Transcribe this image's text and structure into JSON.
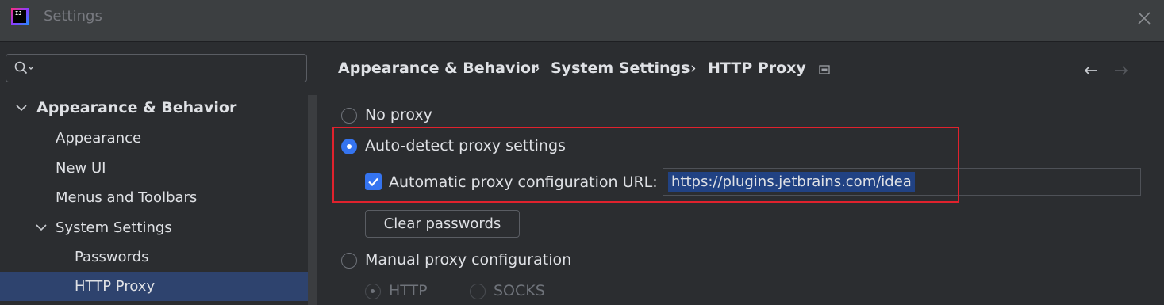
{
  "window": {
    "title": "Settings"
  },
  "search": {
    "placeholder": "",
    "value": ""
  },
  "sidebar": {
    "items": [
      {
        "label": "Appearance & Behavior",
        "level": 0,
        "expanded": true
      },
      {
        "label": "Appearance",
        "level": 1
      },
      {
        "label": "New UI",
        "level": 1
      },
      {
        "label": "Menus and Toolbars",
        "level": 1
      },
      {
        "label": "System Settings",
        "level": 1,
        "expanded": true
      },
      {
        "label": "Passwords",
        "level": 2
      },
      {
        "label": "HTTP Proxy",
        "level": 2,
        "selected": true
      }
    ]
  },
  "breadcrumb": {
    "items": [
      "Appearance & Behavior",
      "System Settings",
      "HTTP Proxy"
    ],
    "separator": "›"
  },
  "proxy": {
    "no_proxy": {
      "label": "No proxy",
      "checked": false
    },
    "auto_detect": {
      "label": "Auto-detect proxy settings",
      "checked": true
    },
    "auto_config_url": {
      "label": "Automatic proxy configuration URL:",
      "checked": true,
      "value": "https://plugins.jetbrains.com/idea"
    },
    "clear_passwords_label": "Clear passwords",
    "manual": {
      "label": "Manual proxy configuration",
      "checked": false
    },
    "manual_types": [
      {
        "label": "HTTP",
        "checked": true,
        "enabled": false
      },
      {
        "label": "SOCKS",
        "checked": false,
        "enabled": false
      }
    ]
  },
  "colors": {
    "accent": "#3574f0",
    "selection": "#2e436e",
    "text_selection": "#214283",
    "highlight_border": "#e0222d"
  }
}
